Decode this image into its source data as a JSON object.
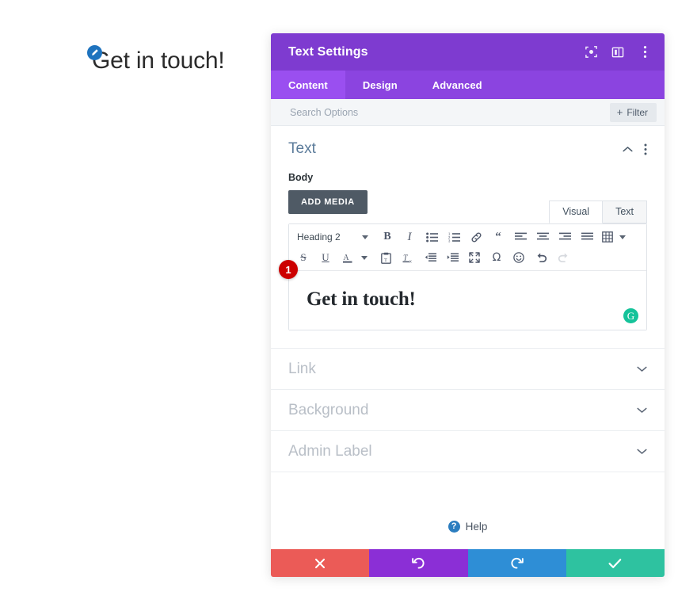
{
  "preview": {
    "heading": "Get in touch!",
    "edit_badge_icon": "pencil-icon",
    "badge_color": "#1e73be"
  },
  "modal": {
    "title": "Text Settings",
    "header_color": "#7e3bd0",
    "tabs_color": "#8b44e0",
    "header_icons": [
      {
        "name": "focus-target-icon"
      },
      {
        "name": "layout-columns-icon"
      },
      {
        "name": "kebab-menu-icon"
      }
    ],
    "tabs": [
      {
        "label": "Content",
        "active": true
      },
      {
        "label": "Design",
        "active": false
      },
      {
        "label": "Advanced",
        "active": false
      }
    ],
    "search": {
      "placeholder": "Search Options",
      "value": ""
    },
    "filter": {
      "label": "Filter",
      "plus": "+"
    },
    "groups": {
      "text": {
        "title": "Text",
        "collapse_icon": "chevron-up-icon",
        "menu_icon": "kebab-menu-icon",
        "body_label": "Body",
        "add_media_label": "ADD MEDIA",
        "step_badge": "1",
        "editor": {
          "tabs": [
            {
              "label": "Visual",
              "active": true
            },
            {
              "label": "Text",
              "active": false
            }
          ],
          "format_select": "Heading 2",
          "toolbar_row1": [
            {
              "name": "bold-icon",
              "glyph": "B"
            },
            {
              "name": "italic-icon",
              "glyph": "I"
            },
            {
              "name": "bulleted-list-icon",
              "glyph": ""
            },
            {
              "name": "numbered-list-icon",
              "glyph": ""
            },
            {
              "name": "link-icon",
              "glyph": ""
            },
            {
              "name": "blockquote-icon",
              "glyph": ""
            },
            {
              "name": "align-left-icon",
              "glyph": ""
            },
            {
              "name": "align-center-icon",
              "glyph": ""
            },
            {
              "name": "align-right-icon",
              "glyph": ""
            },
            {
              "name": "align-justify-icon",
              "glyph": ""
            },
            {
              "name": "table-icon",
              "glyph": ""
            }
          ],
          "toolbar_row2": [
            {
              "name": "strikethrough-icon",
              "glyph": "S"
            },
            {
              "name": "underline-icon",
              "glyph": "U"
            },
            {
              "name": "text-color-icon",
              "glyph": "A"
            },
            {
              "name": "paste-as-text-icon",
              "glyph": ""
            },
            {
              "name": "clear-formatting-icon",
              "glyph": ""
            },
            {
              "name": "outdent-icon",
              "glyph": ""
            },
            {
              "name": "indent-icon",
              "glyph": ""
            },
            {
              "name": "fullscreen-icon",
              "glyph": ""
            },
            {
              "name": "special-character-icon",
              "glyph": "Ω"
            },
            {
              "name": "emoji-icon",
              "glyph": ""
            },
            {
              "name": "undo-icon",
              "glyph": ""
            },
            {
              "name": "redo-icon",
              "glyph": ""
            }
          ],
          "content": "Get in touch!",
          "grammarly_badge": "G"
        }
      }
    },
    "collapsed_sections": [
      {
        "label": "Link",
        "icon": "chevron-down-icon"
      },
      {
        "label": "Background",
        "icon": "chevron-down-icon"
      },
      {
        "label": "Admin Label",
        "icon": "chevron-down-icon"
      }
    ],
    "help": {
      "badge": "?",
      "label": "Help"
    },
    "footer_buttons": [
      {
        "name": "cancel-button",
        "icon": "close-x-icon",
        "color": "#eb5b57"
      },
      {
        "name": "undo-button",
        "icon": "undo-arrow-icon",
        "color": "#8b2fd6"
      },
      {
        "name": "redo-button",
        "icon": "redo-arrow-icon",
        "color": "#2e8ed6"
      },
      {
        "name": "save-button",
        "icon": "checkmark-icon",
        "color": "#2ec2a0"
      }
    ]
  }
}
